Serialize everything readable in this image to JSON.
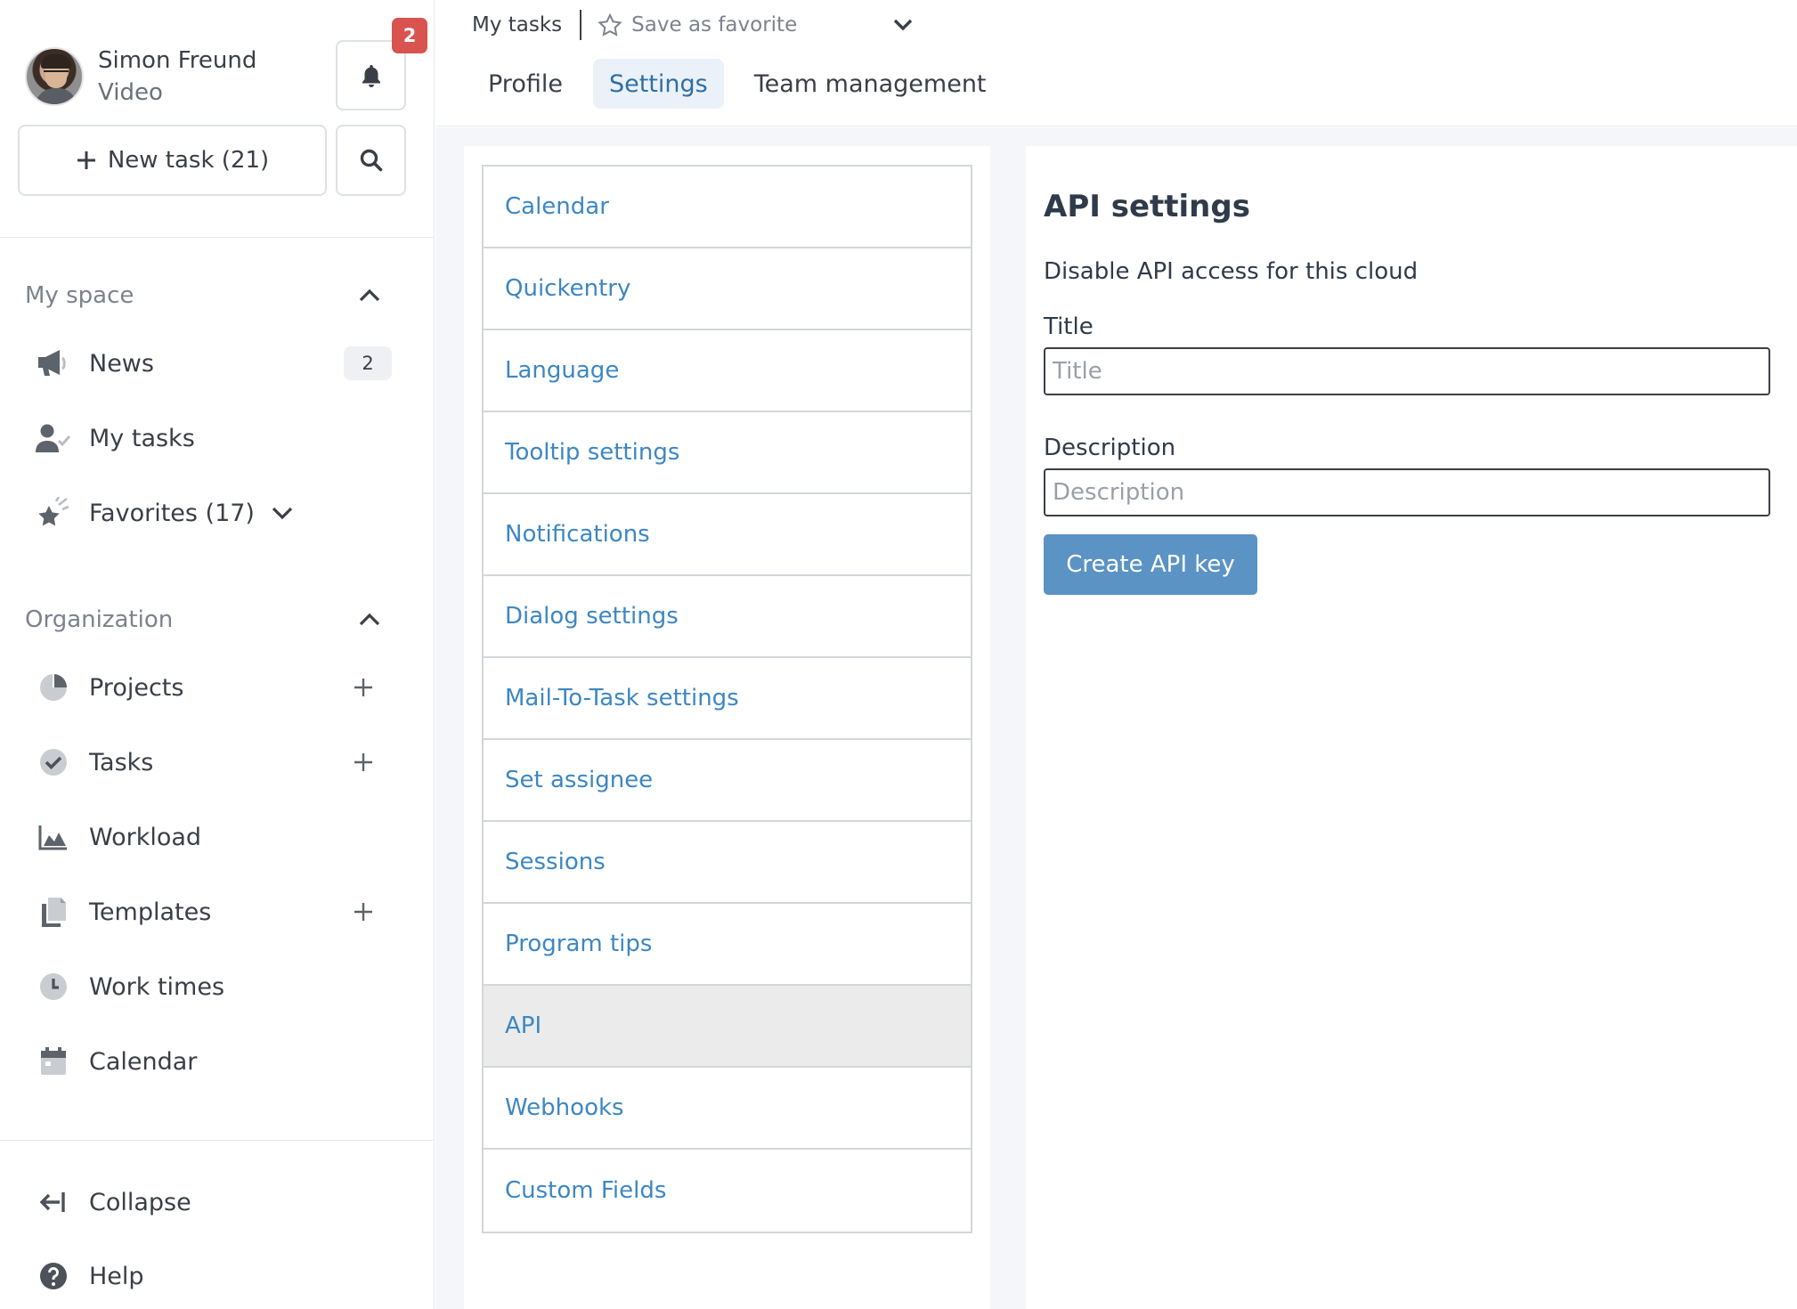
{
  "user": {
    "name": "Simon Freund",
    "subtitle": "Video",
    "notification_count": "2"
  },
  "actions": {
    "new_task_label": "New task (21)"
  },
  "sidebar": {
    "my_space": {
      "heading": "My space",
      "items": [
        {
          "label": "News",
          "icon": "megaphone-icon",
          "count": "2"
        },
        {
          "label": "My tasks",
          "icon": "user-check-icon"
        },
        {
          "label": "Favorites (17)",
          "icon": "star-sparkle-icon"
        }
      ]
    },
    "organization": {
      "heading": "Organization",
      "items": [
        {
          "label": "Projects",
          "icon": "pie-chart-icon"
        },
        {
          "label": "Tasks",
          "icon": "check-circle-icon"
        },
        {
          "label": "Workload",
          "icon": "area-chart-icon"
        },
        {
          "label": "Templates",
          "icon": "copy-icon"
        },
        {
          "label": "Work times",
          "icon": "clock-icon"
        },
        {
          "label": "Calendar",
          "icon": "calendar-icon"
        }
      ]
    },
    "footer": {
      "collapse_label": "Collapse",
      "help_label": "Help"
    }
  },
  "topbar": {
    "breadcrumb": "My tasks",
    "save_favorite_label": "Save as favorite",
    "tabs": [
      {
        "label": "Profile",
        "active": false
      },
      {
        "label": "Settings",
        "active": true
      },
      {
        "label": "Team management",
        "active": false
      }
    ]
  },
  "settings_menu": {
    "items": [
      "Calendar",
      "Quickentry",
      "Language",
      "Tooltip settings",
      "Notifications",
      "Dialog settings",
      "Mail-To-Task settings",
      "Set assignee",
      "Sessions",
      "Program tips",
      "API",
      "Webhooks",
      "Custom Fields"
    ],
    "active_item": "API"
  },
  "api_settings": {
    "title": "API settings",
    "disable_link": "Disable API access for this cloud",
    "title_label": "Title",
    "title_placeholder": "Title",
    "description_label": "Description",
    "description_placeholder": "Description",
    "create_button": "Create API key"
  },
  "colors": {
    "accent": "#5b93c4",
    "link": "#3d87c3",
    "badge": "#d9534f",
    "active_tab_bg": "#eaf1f8"
  }
}
